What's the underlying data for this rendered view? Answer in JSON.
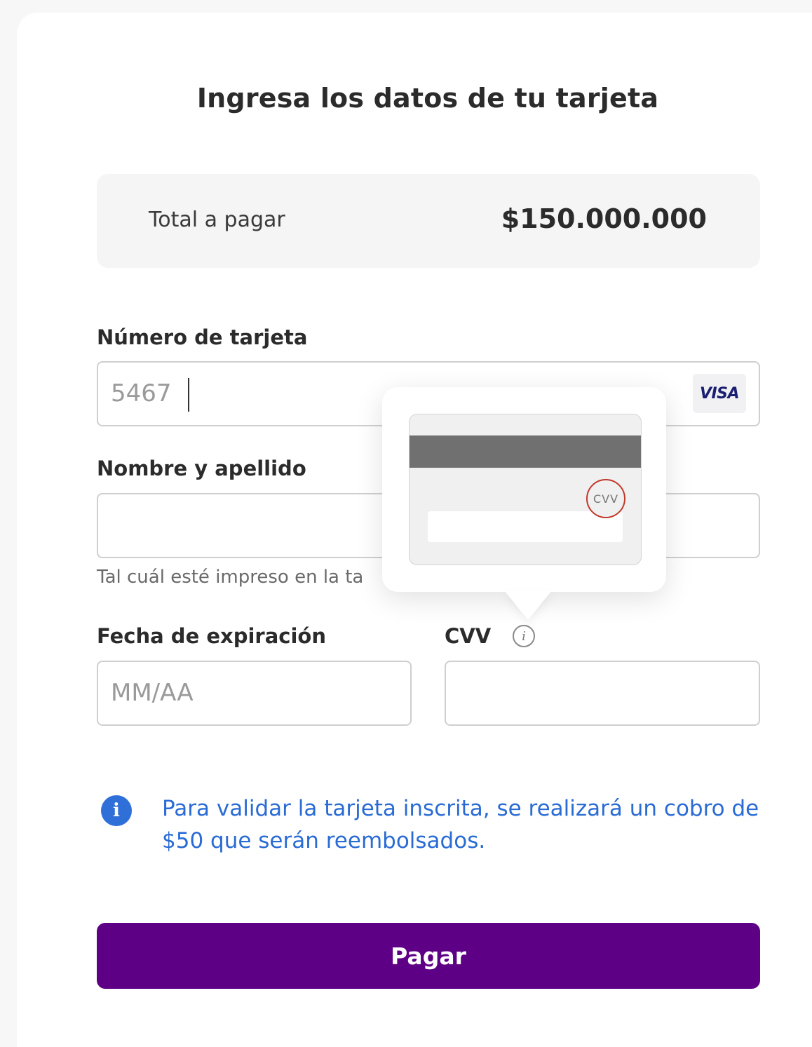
{
  "form": {
    "title": "Ingresa los datos de tu tarjeta",
    "total": {
      "label": "Total a pagar",
      "amount": "$150.000.000"
    },
    "card_number": {
      "label": "Número de tarjeta",
      "value": "5467",
      "brand": "VISA"
    },
    "name": {
      "label": "Nombre y apellido",
      "value": "",
      "helper": "Tal cuál esté impreso en la ta"
    },
    "expiry": {
      "label": "Fecha de expiración",
      "placeholder": "MM/AA"
    },
    "cvv": {
      "label": "CVV",
      "value": "",
      "info_icon": "info-icon"
    },
    "tooltip": {
      "cvv_badge": "CVV"
    },
    "notice": {
      "icon": "info-icon",
      "text": "Para validar la tarjeta inscrita, se realizará un cobro de $50 que serán reembolsados."
    },
    "pay_button": "Pagar"
  },
  "colors": {
    "primary": "#5e0085",
    "notice": "#2a6bd4",
    "cvv_circle": "#c0392b"
  }
}
